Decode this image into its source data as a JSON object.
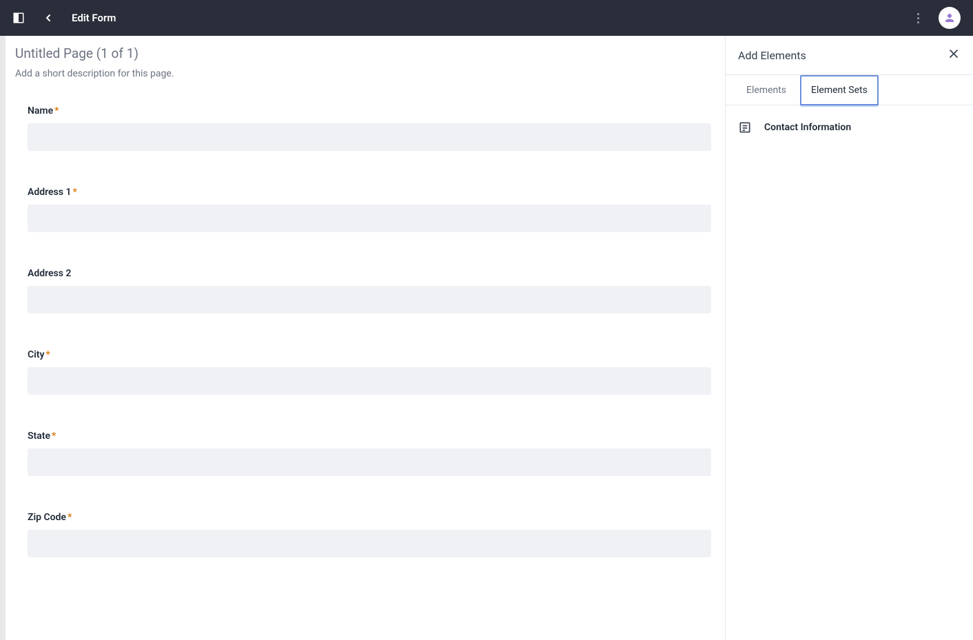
{
  "header": {
    "title": "Edit Form"
  },
  "page": {
    "title": "Untitled Page (1 of 1)",
    "descriptionPlaceholder": "Add a short description for this page."
  },
  "fields": [
    {
      "label": "Name",
      "required": true,
      "value": ""
    },
    {
      "label": "Address 1",
      "required": true,
      "value": ""
    },
    {
      "label": "Address 2",
      "required": false,
      "value": ""
    },
    {
      "label": "City",
      "required": true,
      "value": ""
    },
    {
      "label": "State",
      "required": true,
      "value": ""
    },
    {
      "label": "Zip Code",
      "required": true,
      "value": ""
    }
  ],
  "sidePanel": {
    "title": "Add Elements",
    "tabs": [
      {
        "label": "Elements",
        "active": false
      },
      {
        "label": "Element Sets",
        "active": true
      }
    ],
    "sets": [
      {
        "label": "Contact Information"
      }
    ]
  }
}
